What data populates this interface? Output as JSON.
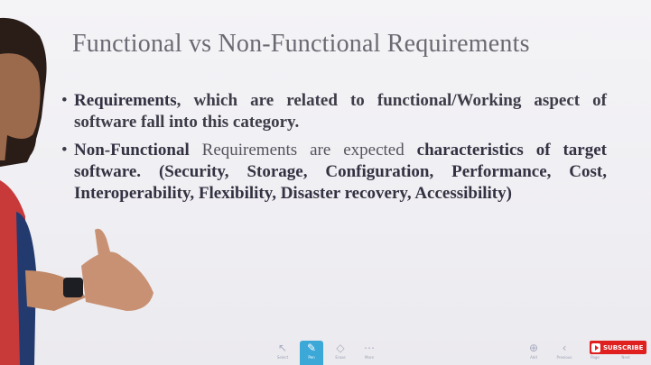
{
  "slide": {
    "title": "Functional vs Non-Functional Requirements",
    "bullets": [
      {
        "lead": "Requirements",
        "rest": ", which are related to functional/Working aspect of software fall into this category."
      },
      {
        "lead": "Non-Functional",
        "middle": " Requirements are expected ",
        "rest": "characteristics of target software. (Security, Storage, Configuration, Performance, Cost, Interoperability, Flexibility, Disaster recovery, Accessibility)"
      }
    ]
  },
  "toolbar": {
    "tools": [
      {
        "icon": "select-icon",
        "label": "Select"
      },
      {
        "icon": "pen-icon",
        "label": "Pen"
      },
      {
        "icon": "eraser-icon",
        "label": "Erase"
      },
      {
        "icon": "more-icon",
        "label": "More"
      }
    ],
    "right_tools": [
      {
        "icon": "add-icon",
        "label": "Add"
      },
      {
        "icon": "previous-icon",
        "label": "Previous"
      },
      {
        "icon": "page-icon",
        "label": "Page"
      },
      {
        "icon": "next-icon",
        "label": "Next"
      }
    ]
  },
  "subscribe": {
    "label": "SUBSCRIBE"
  },
  "colors": {
    "title": "#6b6a73",
    "text": "#3a3946",
    "accent": "#3ca8d8",
    "subscribe": "#e01f1f"
  }
}
